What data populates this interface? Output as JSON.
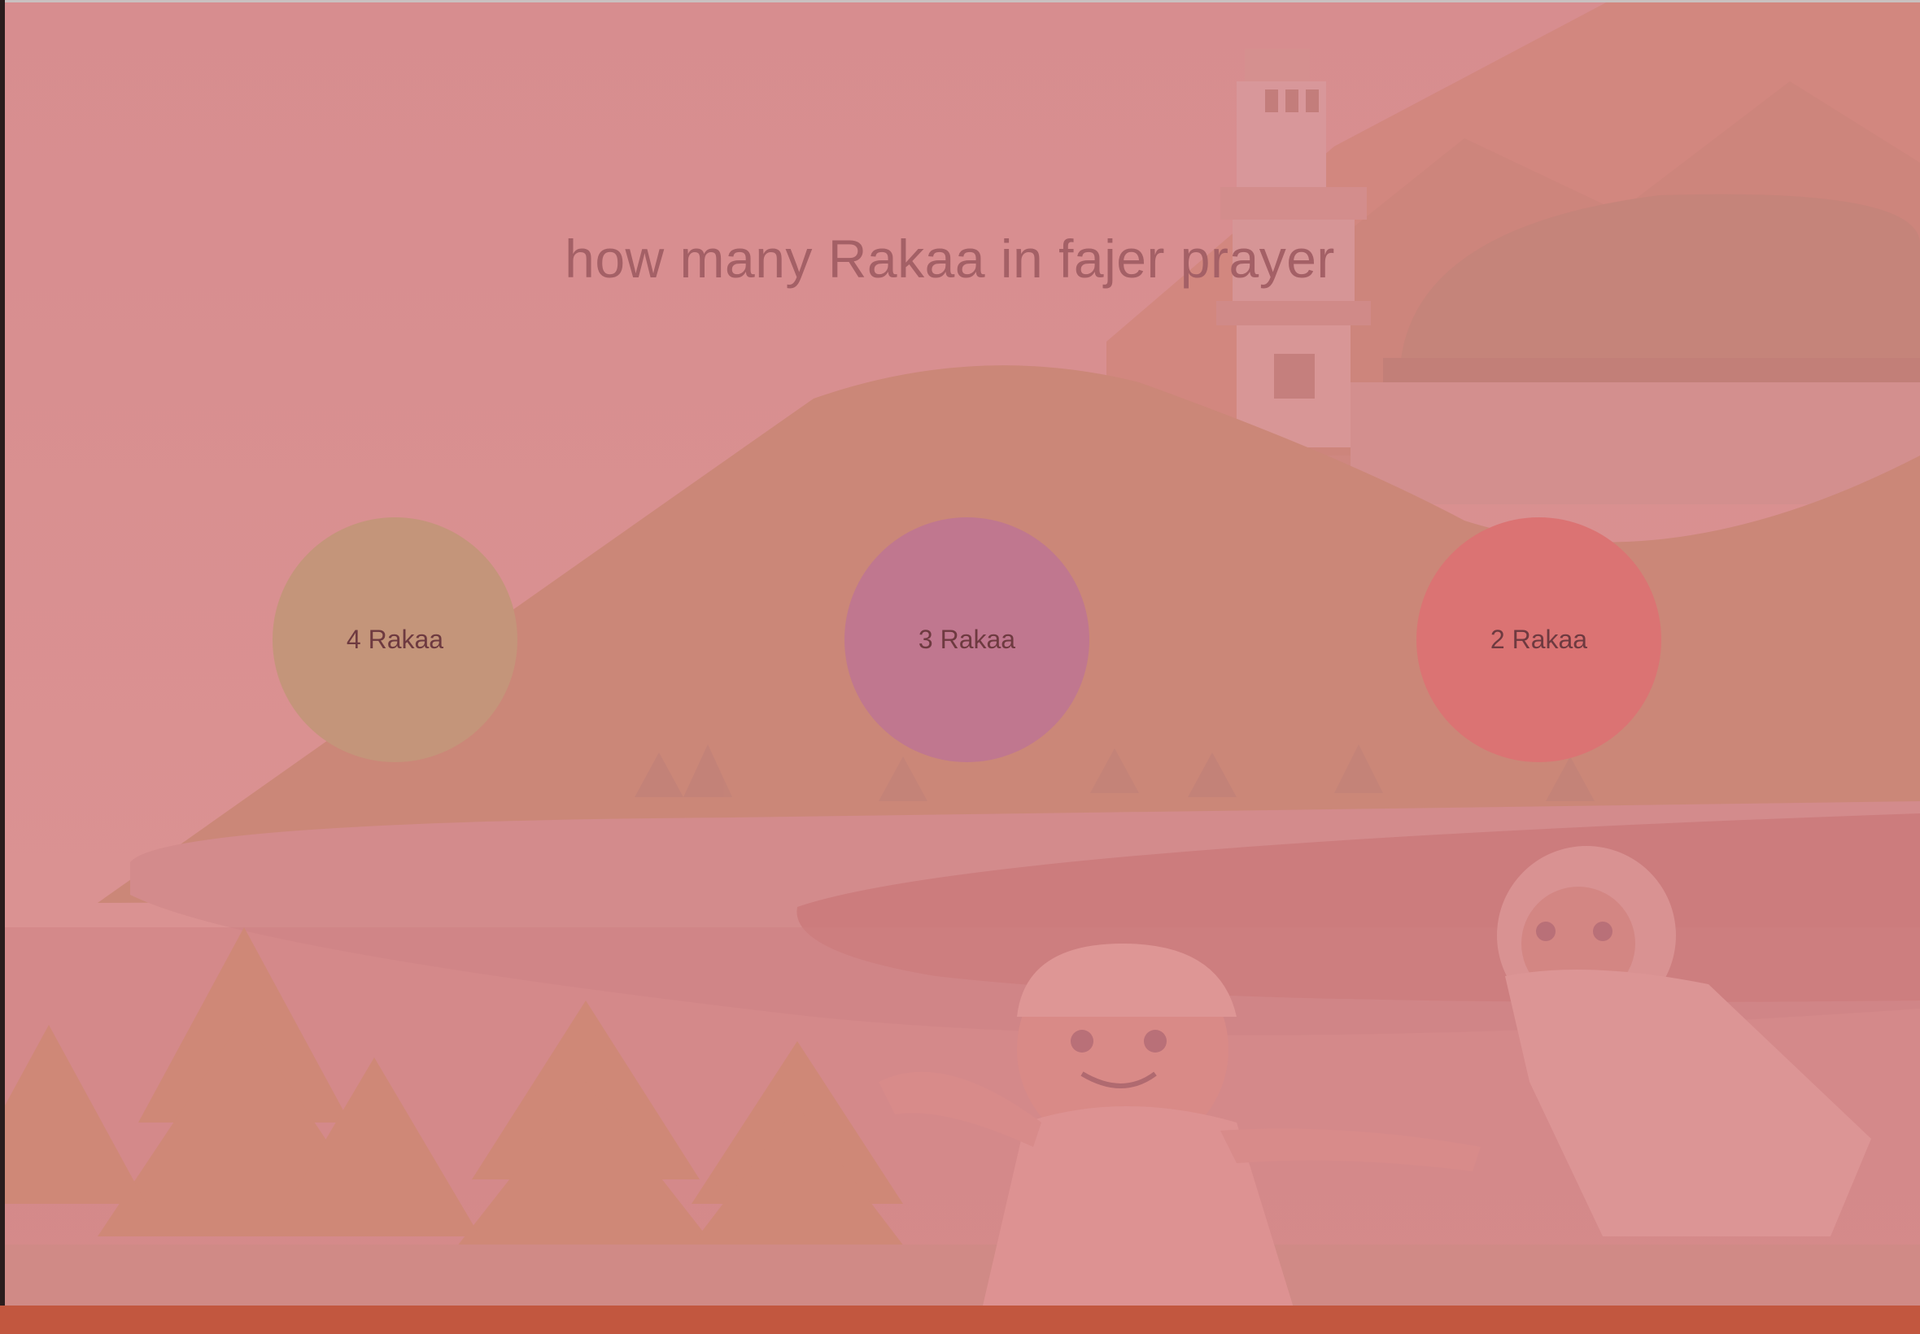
{
  "quiz": {
    "question": "how many Rakaa in fajer prayer",
    "options": [
      {
        "label": "4 Rakaa",
        "color": "#c4957a"
      },
      {
        "label": "3 Rakaa",
        "color": "#c0778f"
      },
      {
        "label": "2 Rakaa",
        "color": "#db7373"
      }
    ]
  },
  "colors": {
    "overlay": "#d99090",
    "bottom_bar": "#c2573f"
  },
  "background": {
    "illustration": "mosque-landscape-with-running-children"
  }
}
